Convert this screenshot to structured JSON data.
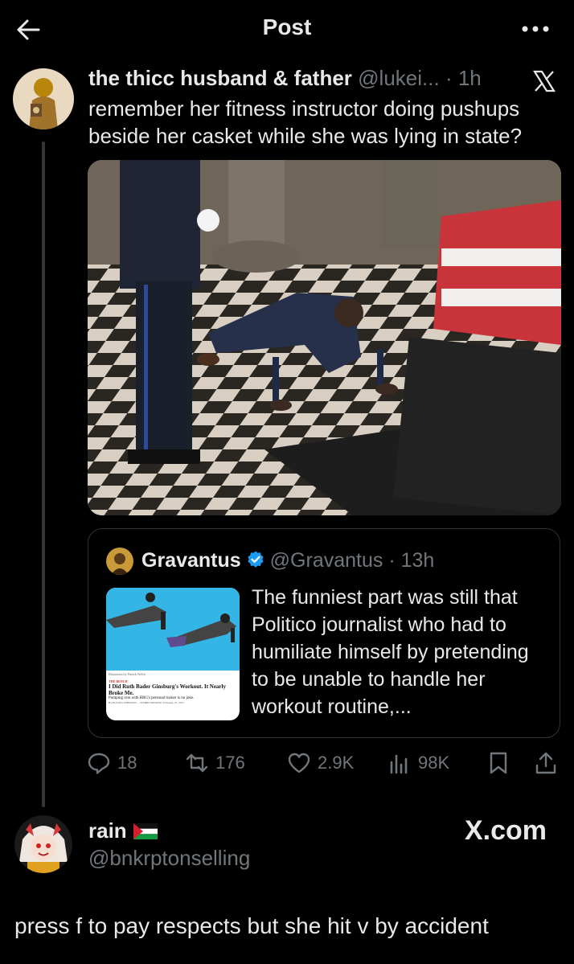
{
  "header": {
    "title": "Post"
  },
  "post": {
    "author_name": "the thicc husband & father",
    "author_handle": "@lukei...",
    "time": "· 1h",
    "text": "remember her fitness instructor doing pushups beside her casket while she was lying in state?",
    "quote": {
      "author_name": "Gravantus",
      "author_handle": "@Gravantus",
      "time": "· 13h",
      "text": "The funniest part was still that Politico journalist who had to humiliate himself by pretending to be unable to handle her workout routine,...",
      "thumb": {
        "credit": "Illustration by Patrick Welsh",
        "section": "THE BENCH",
        "headline": "I Did Ruth Bader Ginsburg's Workout. It Nearly Broke Me.",
        "dek": "Pumping iron with RBG's personal trainer is no joke.",
        "byline": "By ELIANA JOHNSON ... SCHRECKINGER | February 27, 2017"
      }
    },
    "actions": {
      "replies": "18",
      "reposts": "176",
      "likes": "2.9K",
      "views": "98K"
    }
  },
  "reply": {
    "name": "rain",
    "handle": "@bnkrptonselling",
    "watermark": "X.com",
    "text": "press f to pay respects but she hit v by accident"
  },
  "colors": {
    "background": "#000000",
    "text": "#e7e9ea",
    "muted": "#71767b",
    "verified": "#1d9bf0",
    "border": "#2f3336"
  }
}
